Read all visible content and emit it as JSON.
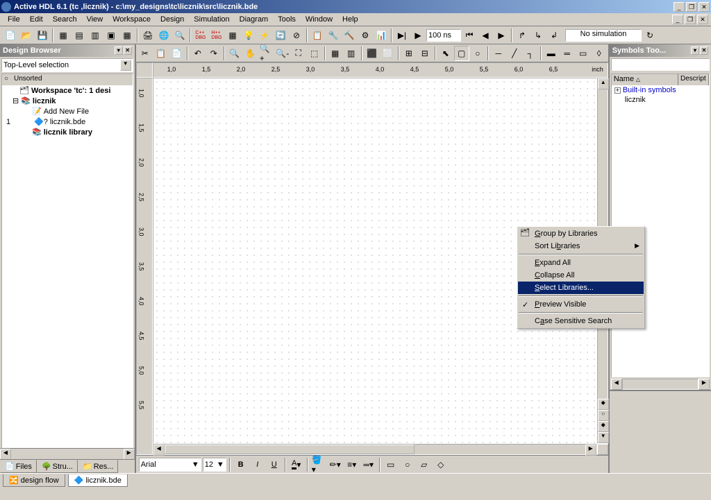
{
  "titlebar": {
    "text": "Active HDL 6.1 (tc ,licznik) - c:\\my_designs\\tc\\licznik\\src\\licznik.bde"
  },
  "menu": {
    "file": "File",
    "edit": "Edit",
    "search": "Search",
    "view": "View",
    "workspace": "Workspace",
    "design": "Design",
    "simulation": "Simulation",
    "diagram": "Diagram",
    "tools": "Tools",
    "window": "Window",
    "help": "Help"
  },
  "toolbar_main": {
    "time_value": "100 ns",
    "sim_status": "No simulation"
  },
  "design_browser": {
    "title": "Design Browser",
    "dropdown": "Top-Level selection",
    "col1": "",
    "col2": "Unsorted",
    "workspace": "Workspace 'tc': 1 desi",
    "design": "licznik",
    "add_new": "Add New File",
    "file1": "licznik.bde",
    "lib": "licznik library",
    "row_marker": "1",
    "tabs": {
      "files": "Files",
      "stru": "Stru...",
      "res": "Res..."
    }
  },
  "ruler": {
    "unit": "inch",
    "h": [
      "1,0",
      "1,5",
      "2,0",
      "2,5",
      "3,0",
      "3,5",
      "4,0",
      "4,5",
      "5,0",
      "5,5",
      "6,0",
      "6,5"
    ],
    "v": [
      "1,0",
      "1,5",
      "2,0",
      "2,5",
      "3,0",
      "3,5",
      "4,0",
      "4,5",
      "5,0",
      "5,5"
    ]
  },
  "format": {
    "font": "Arial",
    "size": "12"
  },
  "symbols": {
    "title": "Symbols Too...",
    "col_name": "Name",
    "col_desc": "Descript",
    "builtin": "Built-in symbols",
    "item": "licznik"
  },
  "status": {
    "designflow": "design flow",
    "file": "licznik.bde"
  },
  "context": {
    "group": "Group by Libraries",
    "sort": "Sort Libraries",
    "expand": "Expand All",
    "collapse": "Collapse All",
    "select": "Select Libraries...",
    "preview": "Preview Visible",
    "search": "Case Sensitive Search"
  }
}
